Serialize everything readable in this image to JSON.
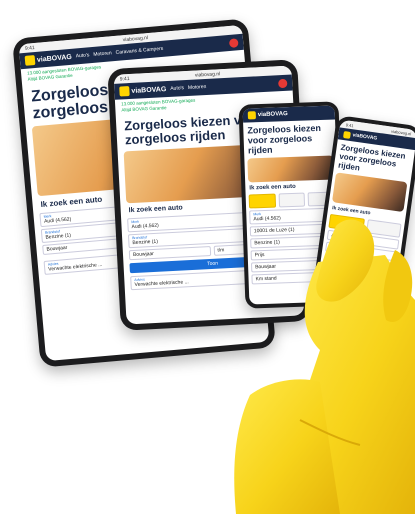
{
  "brand": {
    "name": "viaBOVAG",
    "name_suffix": ".nl",
    "accent": "#ffd400",
    "nav_bg": "#1a2a4a",
    "button": "#1a6ed8"
  },
  "nav": {
    "links": [
      "Auto's",
      "Motoren",
      "Caravans & Campers"
    ]
  },
  "url": "viabovag.nl",
  "status_time": "9:41",
  "checks": [
    "13.000 aangesloten BOVAG-garages",
    "Altijd BOVAG Garantie"
  ],
  "hero": {
    "title": "Zorgeloos kiezen voor zorgeloos rijden"
  },
  "search": {
    "heading": "Ik zoek een auto",
    "brand_label": "Merk",
    "brand_value": "Audi (4.562)",
    "model_label": "Model",
    "model_value": "Model",
    "fuel_label": "Brandstof",
    "fuel_value": "Benzine (1)",
    "year_label": "Bouwjaar",
    "year_value": "Bouwjaar",
    "to_label": "t/m",
    "price_label": "Prijs",
    "km_label": "Km stand",
    "location_value": "10001 de Luze (1)",
    "submit": "Toon"
  },
  "promo": {
    "tag": "Advies",
    "text": "Verwachte elektrische ..."
  }
}
